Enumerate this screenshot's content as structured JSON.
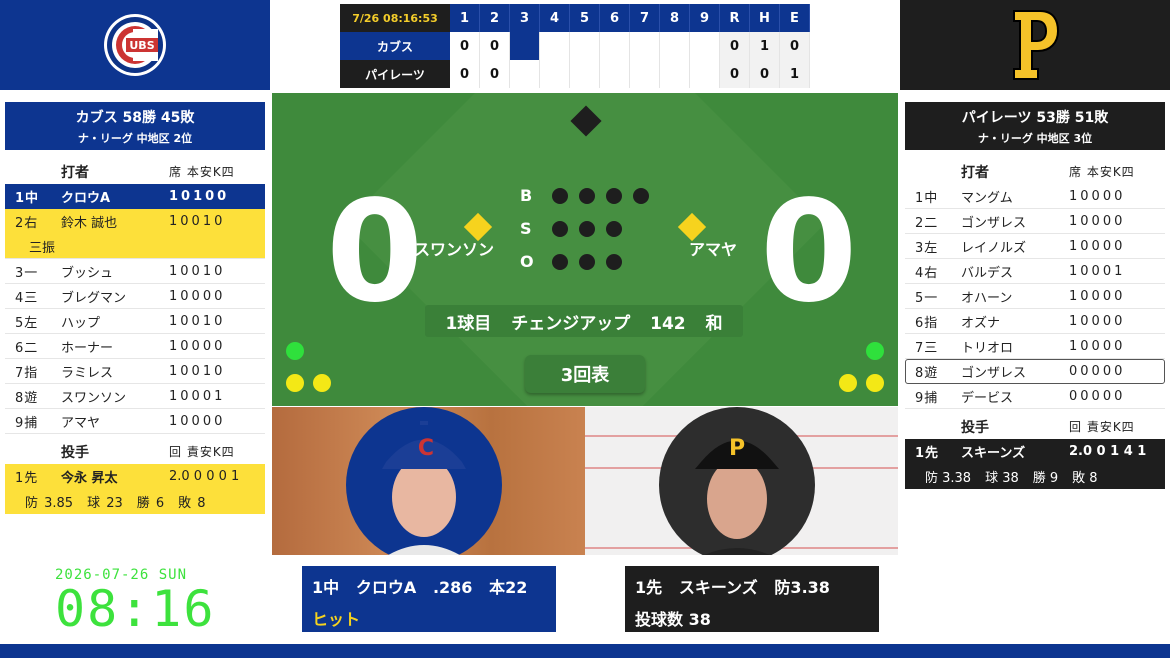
{
  "scoreboard": {
    "datetime": "7/26 08:16:53",
    "innings": [
      "1",
      "2",
      "3",
      "4",
      "5",
      "6",
      "7",
      "8",
      "9"
    ],
    "totals_headers": [
      "R",
      "H",
      "E"
    ],
    "away": {
      "name": "カブス",
      "innings": [
        "0",
        "0",
        "",
        "",
        "",
        "",
        "",
        "",
        ""
      ],
      "R": "0",
      "H": "1",
      "E": "0"
    },
    "home": {
      "name": "パイレーツ",
      "innings": [
        "0",
        "0",
        "",
        "",
        "",
        "",
        "",
        "",
        ""
      ],
      "R": "0",
      "H": "0",
      "E": "1"
    }
  },
  "away_team": {
    "record": "カブス  58勝 45敗",
    "standing": "ナ・リーグ 中地区 2位",
    "batter_header": "打者",
    "batter_stats_header": "席 本安K四",
    "batters": [
      {
        "pos": "1中",
        "name": "クロウA",
        "stats": "10100"
      },
      {
        "pos": "2右",
        "name": "鈴木 誠也",
        "stats": "10010"
      },
      {
        "pos": "3一",
        "name": "ブッシュ",
        "stats": "10010"
      },
      {
        "pos": "4三",
        "name": "ブレグマン",
        "stats": "10000"
      },
      {
        "pos": "5左",
        "name": "ハップ",
        "stats": "10010"
      },
      {
        "pos": "6二",
        "name": "ホーナー",
        "stats": "10000"
      },
      {
        "pos": "7指",
        "name": "ラミレス",
        "stats": "10010"
      },
      {
        "pos": "8遊",
        "name": "スワンソン",
        "stats": "10001"
      },
      {
        "pos": "9捕",
        "name": "アマヤ",
        "stats": "10000"
      }
    ],
    "last_result": "三振",
    "pitcher_header": "投手",
    "pitcher_stats_header": "回 責安K四",
    "pitcher": {
      "pos": "1先",
      "name": "今永 昇太",
      "stats": "2.0 0 0 0 1",
      "era": "防 3.85",
      "pitches": "球 23",
      "wins": "勝 6",
      "losses": "敗 8"
    }
  },
  "home_team": {
    "record": "パイレーツ  53勝 51敗",
    "standing": "ナ・リーグ 中地区 3位",
    "batter_header": "打者",
    "batter_stats_header": "席 本安K四",
    "batters": [
      {
        "pos": "1中",
        "name": "マングム",
        "stats": "10000"
      },
      {
        "pos": "2二",
        "name": "ゴンザレス",
        "stats": "10000"
      },
      {
        "pos": "3左",
        "name": "レイノルズ",
        "stats": "10000"
      },
      {
        "pos": "4右",
        "name": "バルデス",
        "stats": "10001"
      },
      {
        "pos": "5一",
        "name": "オハーン",
        "stats": "10000"
      },
      {
        "pos": "6指",
        "name": "オズナ",
        "stats": "10000"
      },
      {
        "pos": "7三",
        "name": "トリオロ",
        "stats": "10000"
      },
      {
        "pos": "8遊",
        "name": "ゴンザレス",
        "stats": "00000"
      },
      {
        "pos": "9捕",
        "name": "デービス",
        "stats": "00000"
      }
    ],
    "pitcher_header": "投手",
    "pitcher_stats_header": "回 責安K四",
    "pitcher": {
      "pos": "1先",
      "name": "スキーンズ",
      "stats": "2.0 0 1 4 1",
      "era": "防 3.38",
      "pitches": "球 38",
      "wins": "勝 9",
      "losses": "敗 8"
    }
  },
  "field": {
    "away_score": "0",
    "home_score": "0",
    "runner_left": "スワンソン",
    "runner_right": "アマヤ",
    "bso_labels": [
      "B",
      "S",
      "O"
    ],
    "pitch_info": "1球目 チェンジアップ 142 和",
    "inning": "3回表"
  },
  "batter_box": {
    "line1": "1中   クロウA   .286   本22",
    "line2": "ヒット"
  },
  "pitcher_box": {
    "line1": "1先   スキーンズ   防3.38",
    "line2": "投球数 38"
  },
  "clock": {
    "date": "2026-07-26 SUN",
    "time": "08:16"
  },
  "colors": {
    "cubs_blue": "#0d3590",
    "pirates_black": "#1e1e1e",
    "highlight_yellow": "#fde03a",
    "field_green": "#3f8a3c",
    "clock_green": "#3de23d"
  }
}
